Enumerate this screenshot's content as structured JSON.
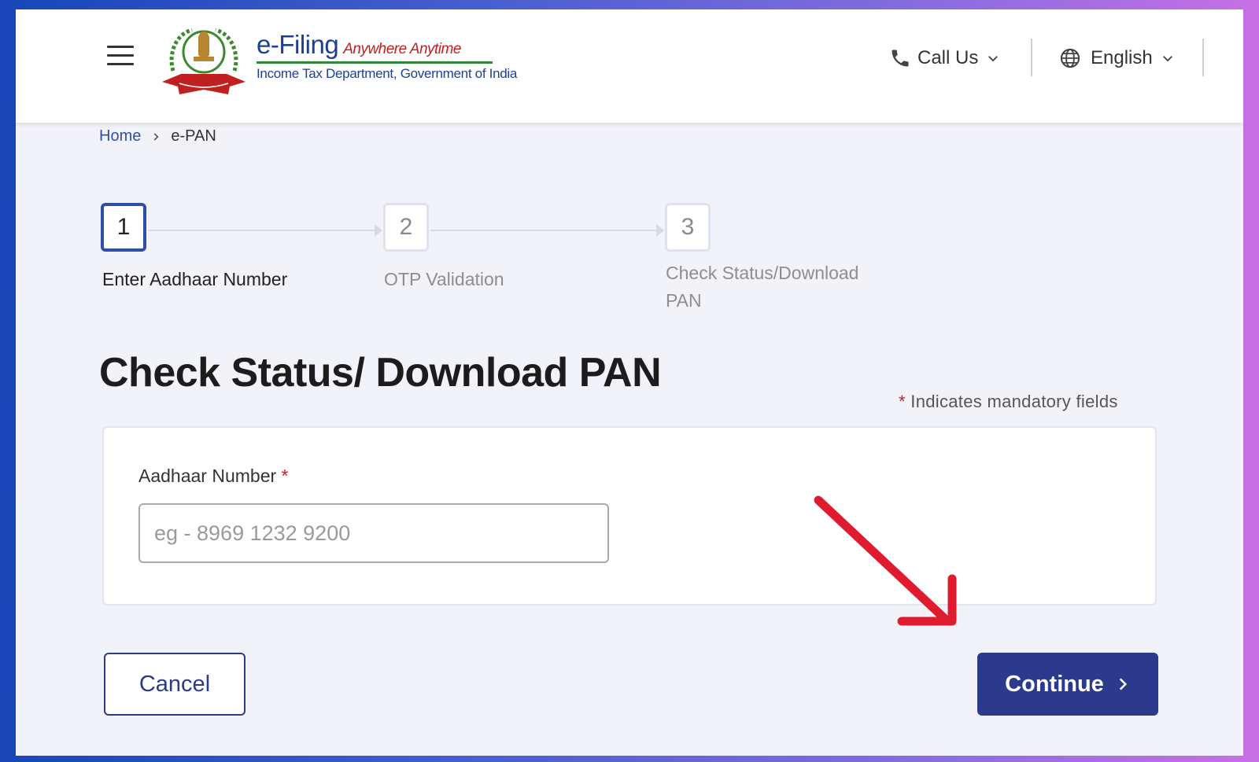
{
  "header": {
    "brand_title": "e-Filing",
    "brand_tagline": "Anywhere Anytime",
    "brand_subtitle": "Income Tax Department, Government of India",
    "call_us_label": "Call Us",
    "language_label": "English"
  },
  "breadcrumb": {
    "home": "Home",
    "current": "e-PAN"
  },
  "stepper": {
    "steps": [
      {
        "number": "1",
        "label_line1": "Enter Aadhaar Number",
        "label_line2": "",
        "state": "active"
      },
      {
        "number": "2",
        "label_line1": "OTP Validation",
        "label_line2": "",
        "state": "inactive"
      },
      {
        "number": "3",
        "label_line1": "Check Status/Download",
        "label_line2": "PAN",
        "state": "inactive"
      }
    ]
  },
  "main": {
    "title": "Check Status/ Download PAN",
    "mandatory_star": "*",
    "mandatory_note": "Indicates mandatory fields"
  },
  "form": {
    "aadhaar_label": "Aadhaar Number",
    "aadhaar_required": "*",
    "aadhaar_placeholder": "eg - 8969 1232 9200",
    "aadhaar_value": ""
  },
  "actions": {
    "cancel_label": "Cancel",
    "continue_label": "Continue"
  },
  "icons": {
    "menu": "hamburger-menu-icon",
    "emblem": "income-tax-department-emblem-icon",
    "call": "phone-icon",
    "language": "globe-icon",
    "dropdown": "chevron-down-icon",
    "breadcrumb_separator": "chevron-right-icon",
    "continue": "chevron-right-icon",
    "annotation": "red-arrow-annotation-icon"
  },
  "colors": {
    "primary": "#2b3a8c",
    "link": "#2f4fa8",
    "required": "#c8202e",
    "annotation": "#e01b2f"
  }
}
